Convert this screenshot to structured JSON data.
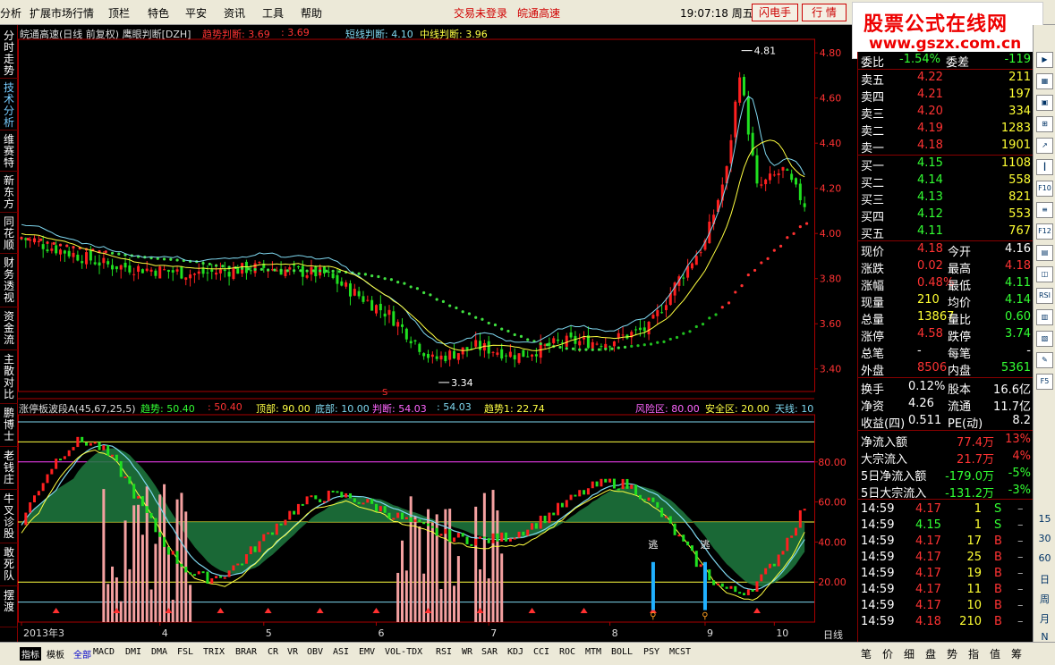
{
  "menubar": {
    "items": [
      "分析",
      "扩展市场行情",
      "顶栏",
      "特色",
      "平安",
      "资讯",
      "工具",
      "帮助"
    ],
    "login_status": "交易未登录",
    "stock_name": "皖通高速",
    "time": "19:07:18 周五",
    "buttons": [
      "闪电手",
      "行 情"
    ]
  },
  "watermark": {
    "line1": "股票公式在线网",
    "line2": "www.gszx.com.cn"
  },
  "left_tabs": [
    "分时走势",
    "技术分析",
    "维赛特",
    "新东方",
    "同花顺",
    "财务透视",
    "资金流",
    "主散对比",
    "鹏博士",
    "老钱庄",
    "牛叉诊股",
    "敢死队",
    "摆渡"
  ],
  "main_header": {
    "title": "皖通高速(日线 前复权) 鹰眼判断[DZH]",
    "trend_label": "趋势判断: 3.69",
    "trend_value2": ": 3.69",
    "short_label": "短线判断: 4.10",
    "mid_label": "中线判断: 3.96"
  },
  "price_axis": [
    "4.80",
    "4.60",
    "4.40",
    "4.20",
    "4.00",
    "3.80",
    "3.60",
    "3.40"
  ],
  "annotations": {
    "high": "4.81",
    "low": "3.34",
    "sig": "S"
  },
  "sub_header": {
    "title": "涨停板波段A(45,67,25,5)",
    "trend": "趋势: 50.40",
    "trend2": ": 50.40",
    "top": "顶部: 90.00",
    "bottom": "底部: 10.00",
    "judge": "判断: 54.03",
    "judge2": ": 54.03",
    "trend1": "趋势1: 22.74",
    "risk": "风险区: 80.00",
    "safe": "安全区: 20.00",
    "sky": "天线: 10"
  },
  "sub_axis": [
    "80.00",
    "60.00",
    "40.00",
    "20.00"
  ],
  "escape_labels": [
    "逃",
    "逃"
  ],
  "date_axis": [
    "2013年3",
    "4",
    "5",
    "6",
    "7",
    "8",
    "9",
    "10"
  ],
  "period_label": "日线",
  "quote": {
    "weibi": {
      "label": "委比",
      "value": "-1.54%",
      "label2": "委差",
      "value2": "-119"
    },
    "sell": [
      {
        "label": "卖五",
        "price": "4.22",
        "vol": "211"
      },
      {
        "label": "卖四",
        "price": "4.21",
        "vol": "197"
      },
      {
        "label": "卖三",
        "price": "4.20",
        "vol": "334"
      },
      {
        "label": "卖二",
        "price": "4.19",
        "vol": "1283"
      },
      {
        "label": "卖一",
        "price": "4.18",
        "vol": "1901"
      }
    ],
    "buy": [
      {
        "label": "买一",
        "price": "4.15",
        "vol": "1108"
      },
      {
        "label": "买二",
        "price": "4.14",
        "vol": "558"
      },
      {
        "label": "买三",
        "price": "4.13",
        "vol": "821"
      },
      {
        "label": "买四",
        "price": "4.12",
        "vol": "553"
      },
      {
        "label": "买五",
        "price": "4.11",
        "vol": "767"
      }
    ],
    "stats": [
      {
        "l1": "现价",
        "v1": "4.18",
        "c1": "#f33",
        "l2": "今开",
        "v2": "4.16",
        "c2": "#fff"
      },
      {
        "l1": "涨跌",
        "v1": "0.02",
        "c1": "#f33",
        "l2": "最高",
        "v2": "4.18",
        "c2": "#f33"
      },
      {
        "l1": "涨幅",
        "v1": "0.48%",
        "c1": "#f33",
        "l2": "最低",
        "v2": "4.11",
        "c2": "#3f3"
      },
      {
        "l1": "现量",
        "v1": "210",
        "c1": "#ff3",
        "l2": "均价",
        "v2": "4.14",
        "c2": "#3f3"
      },
      {
        "l1": "总量",
        "v1": "13867",
        "c1": "#ff3",
        "l2": "量比",
        "v2": "0.60",
        "c2": "#3f3"
      },
      {
        "l1": "涨停",
        "v1": "4.58",
        "c1": "#f33",
        "l2": "跌停",
        "v2": "3.74",
        "c2": "#3f3"
      },
      {
        "l1": "总笔",
        "v1": "-",
        "c1": "#fff",
        "l2": "每笔",
        "v2": "-",
        "c2": "#fff"
      },
      {
        "l1": "外盘",
        "v1": "8506",
        "c1": "#f33",
        "l2": "内盘",
        "v2": "5361",
        "c2": "#3f3"
      }
    ],
    "fund": [
      {
        "l1": "换手",
        "v1": "0.12%",
        "l2": "股本",
        "v2": "16.6亿"
      },
      {
        "l1": "净资",
        "v1": "4.26",
        "l2": "流通",
        "v2": "11.7亿"
      },
      {
        "l1": "收益(四)",
        "v1": "0.511",
        "l2": "PE(动)",
        "v2": "8.2"
      }
    ],
    "flow": [
      {
        "label": "净流入额",
        "value": "77.4万",
        "pct": "13%",
        "color": "#f33"
      },
      {
        "label": "大宗流入",
        "value": "21.7万",
        "pct": "4%",
        "color": "#f33"
      },
      {
        "label": "5日净流入额",
        "value": "-179.0万",
        "pct": "-5%",
        "color": "#3f3"
      },
      {
        "label": "5日大宗流入",
        "value": "-131.2万",
        "pct": "-3%",
        "color": "#3f3"
      }
    ],
    "ticks": [
      {
        "t": "14:59",
        "p": "4.17",
        "pc": "#f33",
        "v": "1",
        "s": "S",
        "sc": "#3f3"
      },
      {
        "t": "14:59",
        "p": "4.15",
        "pc": "#3f3",
        "v": "1",
        "s": "S",
        "sc": "#3f3"
      },
      {
        "t": "14:59",
        "p": "4.17",
        "pc": "#f33",
        "v": "17",
        "s": "B",
        "sc": "#f33"
      },
      {
        "t": "14:59",
        "p": "4.17",
        "pc": "#f33",
        "v": "25",
        "s": "B",
        "sc": "#f33"
      },
      {
        "t": "14:59",
        "p": "4.17",
        "pc": "#f33",
        "v": "19",
        "s": "B",
        "sc": "#f33"
      },
      {
        "t": "14:59",
        "p": "4.17",
        "pc": "#f33",
        "v": "11",
        "s": "B",
        "sc": "#f33"
      },
      {
        "t": "14:59",
        "p": "4.17",
        "pc": "#f33",
        "v": "10",
        "s": "B",
        "sc": "#f33"
      },
      {
        "t": "14:59",
        "p": "4.18",
        "pc": "#f33",
        "v": "210",
        "s": "B",
        "sc": "#f33"
      }
    ]
  },
  "icon_col_text": [
    "15",
    "30",
    "60",
    "日",
    "周",
    "月",
    "N"
  ],
  "bottom_tabs": [
    "指标",
    "模板",
    "全部",
    "MACD",
    "DMI",
    "DMA",
    "FSL",
    "TRIX",
    "BRAR",
    "CR",
    "VR",
    "OBV",
    "ASI",
    "EMV",
    "VOL-TDX",
    "RSI",
    "WR",
    "SAR",
    "KDJ",
    "CCI",
    "ROC",
    "MTM",
    "BOLL",
    "PSY",
    "MCST"
  ],
  "right_tabs": [
    "笔",
    "价",
    "细",
    "盘",
    "势",
    "指",
    "值",
    "筹"
  ],
  "colors": {
    "up": "#ff2020",
    "down": "#20e020",
    "cyan": "#7fd8f0",
    "yellow": "#ffff40"
  }
}
